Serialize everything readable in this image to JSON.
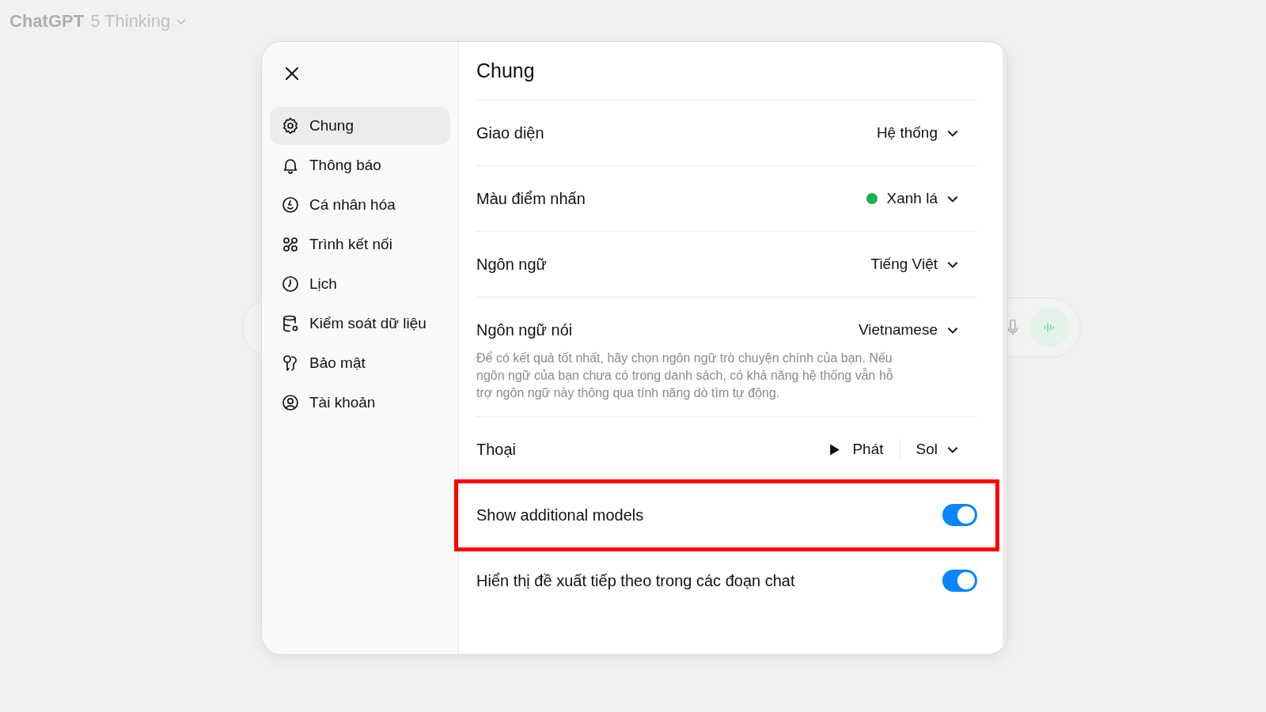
{
  "background": {
    "app_name": "ChatGPT",
    "model": "5 Thinking"
  },
  "sidebar": {
    "items": [
      {
        "label": "Chung",
        "selected": true
      },
      {
        "label": "Thông báo",
        "selected": false
      },
      {
        "label": "Cá nhân hóa",
        "selected": false
      },
      {
        "label": "Trình kết nối",
        "selected": false
      },
      {
        "label": "Lịch",
        "selected": false
      },
      {
        "label": "Kiểm soát dữ liệu",
        "selected": false
      },
      {
        "label": "Bảo mật",
        "selected": false
      },
      {
        "label": "Tài khoản",
        "selected": false
      }
    ]
  },
  "panel": {
    "title": "Chung",
    "rows": [
      {
        "kind": "select",
        "label": "Giao diện",
        "value": "Hệ thống",
        "highlighted": false
      },
      {
        "kind": "select",
        "label": "Màu điểm nhấn",
        "value": "Xanh lá",
        "color": "#16b64a",
        "highlighted": false
      },
      {
        "kind": "select",
        "label": "Ngôn ngữ",
        "value": "Tiếng Việt",
        "highlighted": false
      },
      {
        "kind": "select",
        "label": "Ngôn ngữ nói",
        "value": "Vietnamese",
        "description": "Để có kết quả tốt nhất, hãy chọn ngôn ngữ trò chuyện chính của bạn. Nếu ngôn ngữ của bạn chưa có trong danh sách, có khả năng hệ thống vẫn hỗ trợ ngôn ngữ này thông qua tính năng dò tìm tự động.",
        "highlighted": false
      },
      {
        "kind": "voice",
        "label": "Thoại",
        "play": "Phát",
        "value": "Sol",
        "highlighted": false
      },
      {
        "kind": "toggle",
        "label": "Show additional models",
        "on": true,
        "highlighted": true
      },
      {
        "kind": "toggle",
        "label": "Hiển thị đề xuất tiếp theo trong các đoạn chat",
        "on": true,
        "highlighted": false
      }
    ]
  }
}
